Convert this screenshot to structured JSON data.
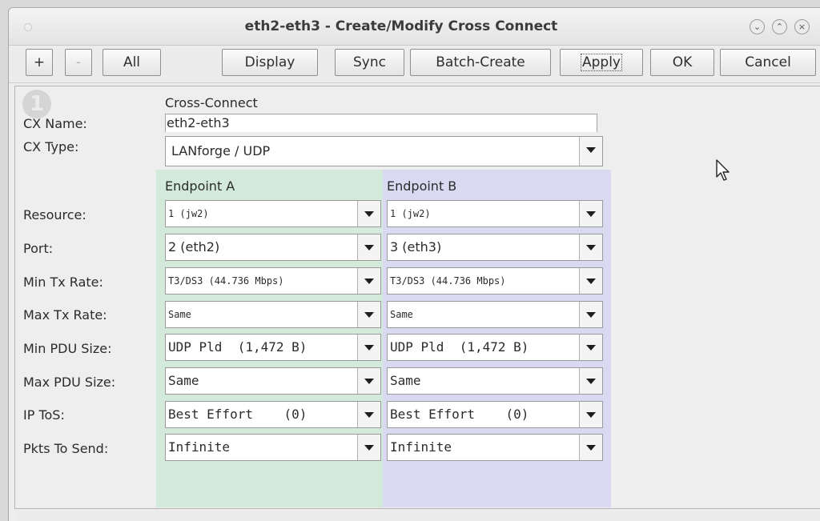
{
  "window": {
    "title": "eth2-eth3 - Create/Modify Cross Connect",
    "controls": [
      "⌄",
      "⌃",
      "×"
    ]
  },
  "toolbar": {
    "plus": "+",
    "minus": "-",
    "all": "All",
    "display": "Display",
    "sync": "Sync",
    "batch_create": "Batch-Create",
    "apply": "Apply",
    "ok": "OK",
    "cancel": "Cancel"
  },
  "form": {
    "badge": "1",
    "section_title": "Cross-Connect",
    "cx_name_label": "CX Name:",
    "cx_name_value": "eth2-eth3",
    "cx_type_label": "CX Type:",
    "cx_type_value": "LANforge / UDP",
    "endpoint_a_title": "Endpoint A",
    "endpoint_b_title": "Endpoint B",
    "rows": [
      {
        "label": "Resource:",
        "a": "1 (jw2)",
        "b": "1 (jw2)"
      },
      {
        "label": "Port:",
        "a": "2 (eth2)",
        "b": "3 (eth3)"
      },
      {
        "label": "Min Tx Rate:",
        "a": "T3/DS3 (44.736 Mbps)",
        "b": "T3/DS3 (44.736 Mbps)"
      },
      {
        "label": "Max Tx Rate:",
        "a": "Same",
        "b": "Same"
      },
      {
        "label": "Min PDU Size:",
        "a": "UDP Pld  (1,472 B)",
        "b": "UDP Pld  (1,472 B)"
      },
      {
        "label": "Max PDU Size:",
        "a": "Same",
        "b": "Same"
      },
      {
        "label": "IP ToS:",
        "a": "Best Effort    (0)",
        "b": "Best Effort    (0)"
      },
      {
        "label": "Pkts To Send:",
        "a": "Infinite",
        "b": "Infinite"
      }
    ]
  },
  "colors": {
    "endpoint_a_bg": "#d3eadb",
    "endpoint_b_bg": "#d9daf2",
    "window_bg": "#eeeeee"
  },
  "icons": [
    "window-dot-icon",
    "minimize-icon",
    "maximize-icon",
    "close-icon",
    "dropdown-arrow-icon",
    "mouse-cursor-icon"
  ]
}
